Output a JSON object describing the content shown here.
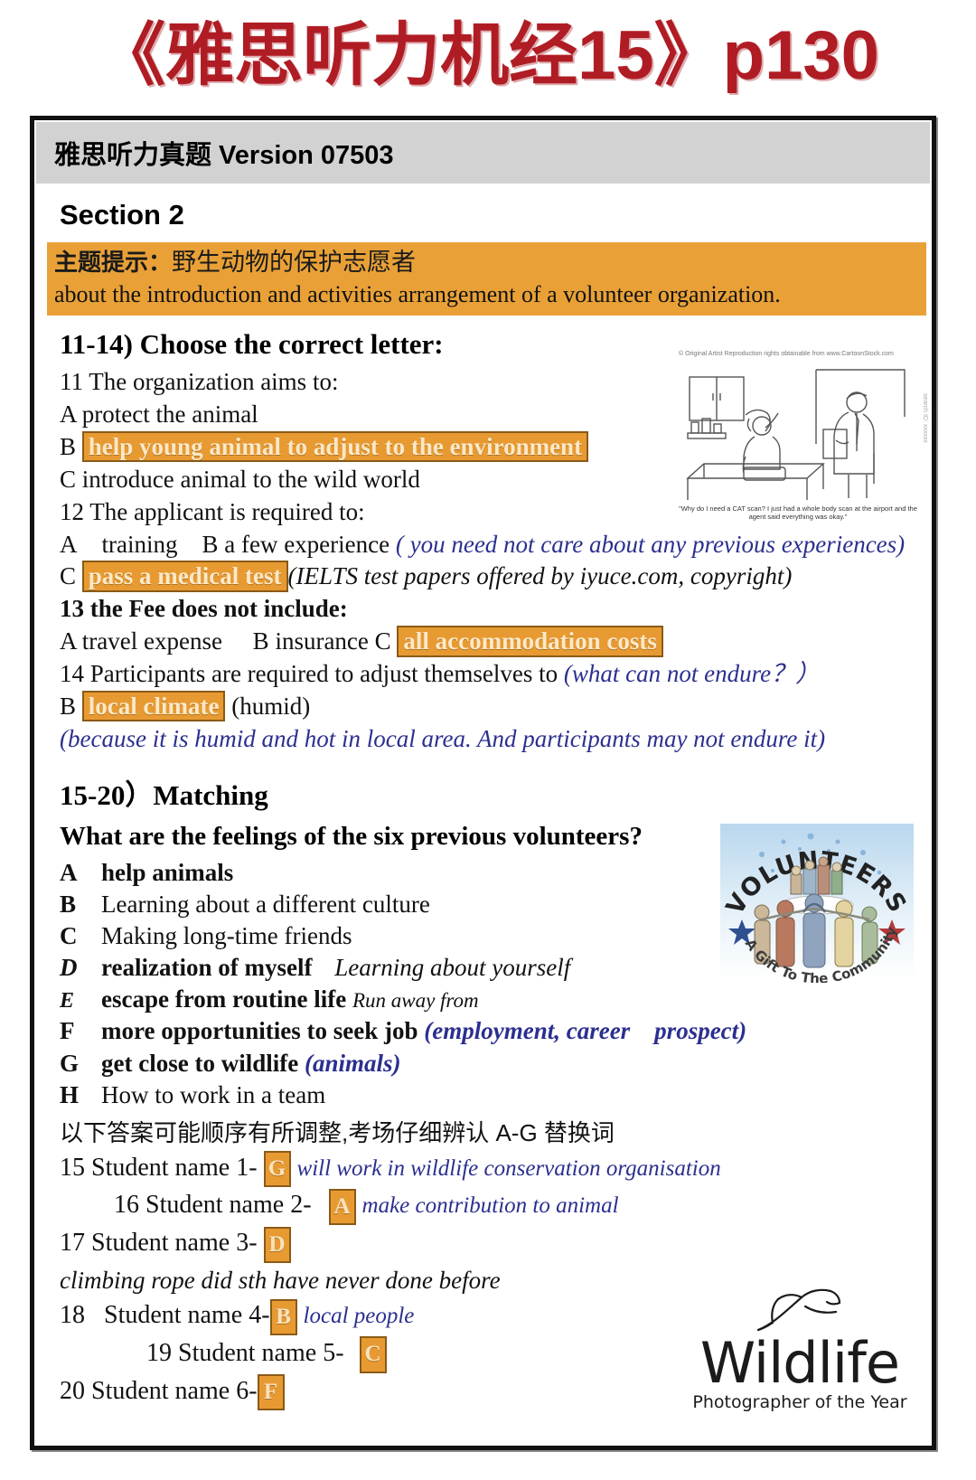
{
  "header": {
    "title": "《雅思听力机经15》p130",
    "version_bar": "雅思听力真题 Version 07503"
  },
  "section": {
    "label": "Section 2",
    "topic_prefix": "主题提示：",
    "topic_cn": "野生动物的保护志愿者",
    "topic_en": "about the introduction and activities arrangement of a volunteer organization."
  },
  "part1": {
    "heading": "11-14) Choose the correct letter:",
    "q11": {
      "stem": "11 The organization aims to:",
      "a": "A protect the animal",
      "b_letter": "B",
      "b_highlight": "help young animal to adjust to the environment",
      "c": "C introduce animal to the wild world"
    },
    "q12": {
      "stem": "12 The applicant is required to:",
      "ab": "A training B a few experience",
      "ab_note": "( you need not care about any previous experiences)",
      "c_letter": "C",
      "c_highlight": "pass a medical test",
      "c_note": "(IELTS test papers offered by iyuce.com, copyright)"
    },
    "q13": {
      "stem": "13 the Fee does not include:",
      "ab": "A travel expense  B insurance C",
      "c_highlight": "all accommodation costs"
    },
    "q14": {
      "stem": "14 Participants are required to adjust themselves to",
      "stem_note": "(what can not endure？）",
      "b_letter": "B",
      "b_highlight": "local climate",
      "b_tail": "(humid)",
      "explain": "(because it is humid and hot in local area. And participants may not endure it)"
    }
  },
  "part2": {
    "heading": "15-20）Matching",
    "question": "What are the feelings of the six previous volunteers?",
    "options": [
      {
        "key": "A",
        "text": "help animals",
        "bold": true,
        "note": "",
        "note_color": ""
      },
      {
        "key": "B",
        "text": "Learning about a different culture",
        "bold": false,
        "note": "",
        "note_color": ""
      },
      {
        "key": "C",
        "text": "Making long-time friends",
        "bold": false,
        "note": "",
        "note_color": ""
      },
      {
        "key": "D",
        "text": "realization of myself",
        "bold": true,
        "note": "Learning about yourself",
        "note_color": "black"
      },
      {
        "key": "E",
        "text": "escape from routine life",
        "bold": true,
        "note": "Run away from",
        "note_color": "black"
      },
      {
        "key": "F",
        "text": "more opportunities to seek job",
        "bold": true,
        "note": "(employment, career prospect)",
        "note_color": "blue"
      },
      {
        "key": "G",
        "text": "get close to wildlife",
        "bold": true,
        "note": "(animals)",
        "note_color": "blue"
      },
      {
        "key": "H",
        "text": "How to work in a team",
        "bold": false,
        "note": "",
        "note_color": ""
      }
    ],
    "cn_note": "以下答案可能顺序有所调整,考场仔细辨认 A-G 替换词",
    "answers": [
      {
        "num": "15",
        "name": "Student name 1-",
        "letter": "G",
        "note": "will work in wildlife conservation organisation",
        "indent": 0
      },
      {
        "num": "16",
        "name": "Student name 2-",
        "letter": "A",
        "note": "make contribution to animal",
        "indent": 1
      },
      {
        "num": "17",
        "name": "Student name 3-",
        "letter": "D",
        "note": "",
        "indent": 0
      },
      {
        "num": "18",
        "name": "Student name 4-",
        "letter": "B",
        "note": "local people",
        "indent": 0
      },
      {
        "num": "19",
        "name": "Student name 5-",
        "letter": "C",
        "note": "",
        "indent": 2
      },
      {
        "num": "20",
        "name": "Student name 6-",
        "letter": "F",
        "note": "",
        "indent": 0
      }
    ],
    "answer17_explain": "climbing rope did sth have never done before"
  },
  "cartoon": {
    "credit": "© Original Artist\nReproduction rights obtainable from\nwww.CartoonStock.com",
    "caption": "\"Why do I need a CAT scan? I just had a whole body scan at the airport and the agent said everything was okay.\"",
    "side_credit": "search ID: xxxxxx"
  },
  "volunteers_logo": {
    "arc_text": "VOLUNTEERS",
    "bottom_text": "A Gift To The Community"
  },
  "wildlife_logo": {
    "word": "Wildlife",
    "sub": "Photographer of the Year"
  },
  "colors": {
    "title_red": "#b01c24",
    "banner_orange": "#e9a137",
    "highlight_orange": "#e89a32",
    "highlight_border": "#8a5a17",
    "note_blue": "#2b2f8f",
    "version_gray": "#d2d2d2"
  }
}
